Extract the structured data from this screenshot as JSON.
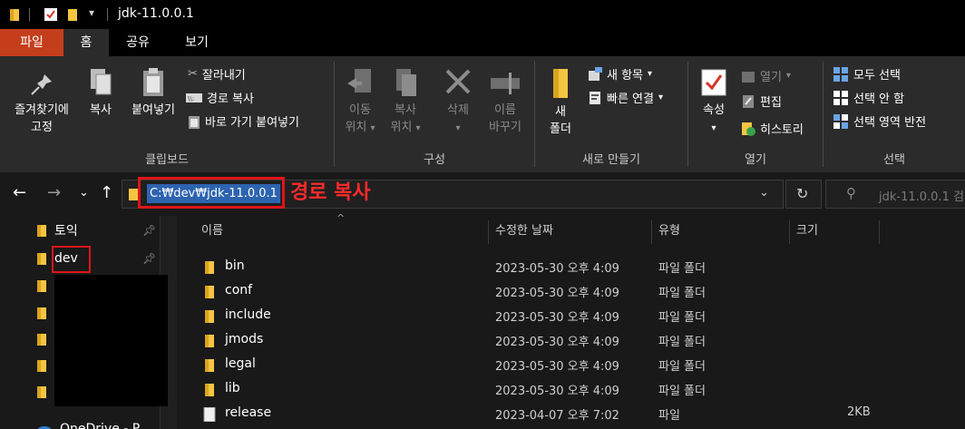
{
  "window": {
    "title": "jdk-11.0.0.1"
  },
  "tabs": {
    "file": "파일",
    "home": "홈",
    "share": "공유",
    "view": "보기"
  },
  "clipboard": {
    "pin_line1": "즐겨찾기에",
    "pin_line2": "고정",
    "copy": "복사",
    "paste": "붙여넣기",
    "cut": "잘라내기",
    "copy_path": "경로 복사",
    "paste_shortcut": "바로 가기 붙여넣기",
    "label": "클립보드"
  },
  "organize": {
    "move_line1": "이동",
    "move_line2": "위치",
    "copyto_line1": "복사",
    "copyto_line2": "위치",
    "delete": "삭제",
    "rename_line1": "이름",
    "rename_line2": "바꾸기",
    "label": "구성"
  },
  "new": {
    "folder_line1": "새",
    "folder_line2": "폴더",
    "new_item": "새 항목",
    "easy_access": "빠른 연결",
    "label": "새로 만들기"
  },
  "open": {
    "properties": "속성",
    "open": "열기",
    "edit": "편집",
    "history": "히스토리",
    "label": "열기"
  },
  "select": {
    "select_all": "모두 선택",
    "select_none": "선택 안 함",
    "invert": "선택 영역 반전",
    "label": "선택"
  },
  "address": {
    "path": "C:₩dev₩jdk-11.0.0.1",
    "annotation": "경로 복사",
    "search_placeholder": "jdk-11.0.0.1 검"
  },
  "nav": {
    "items": [
      {
        "label": "토익"
      },
      {
        "label": "dev"
      },
      {
        "label": "OneDrive - P"
      }
    ]
  },
  "columns": {
    "name": "이름",
    "date": "수정한 날짜",
    "type": "유형",
    "size": "크기"
  },
  "files": [
    {
      "name": "bin",
      "date": "2023-05-30 오후 4:09",
      "type": "파일 폴더",
      "size": "",
      "kind": "folder"
    },
    {
      "name": "conf",
      "date": "2023-05-30 오후 4:09",
      "type": "파일 폴더",
      "size": "",
      "kind": "folder"
    },
    {
      "name": "include",
      "date": "2023-05-30 오후 4:09",
      "type": "파일 폴더",
      "size": "",
      "kind": "folder"
    },
    {
      "name": "jmods",
      "date": "2023-05-30 오후 4:09",
      "type": "파일 폴더",
      "size": "",
      "kind": "folder"
    },
    {
      "name": "legal",
      "date": "2023-05-30 오후 4:09",
      "type": "파일 폴더",
      "size": "",
      "kind": "folder"
    },
    {
      "name": "lib",
      "date": "2023-05-30 오후 4:09",
      "type": "파일 폴더",
      "size": "",
      "kind": "folder"
    },
    {
      "name": "release",
      "date": "2023-04-07 오후 7:02",
      "type": "파일",
      "size": "2KB",
      "kind": "file"
    }
  ],
  "colors": {
    "accent_file_tab": "#c43e1c",
    "folder": "#f4c542",
    "selection": "#2d64b0",
    "annotation": "#e0141a"
  }
}
